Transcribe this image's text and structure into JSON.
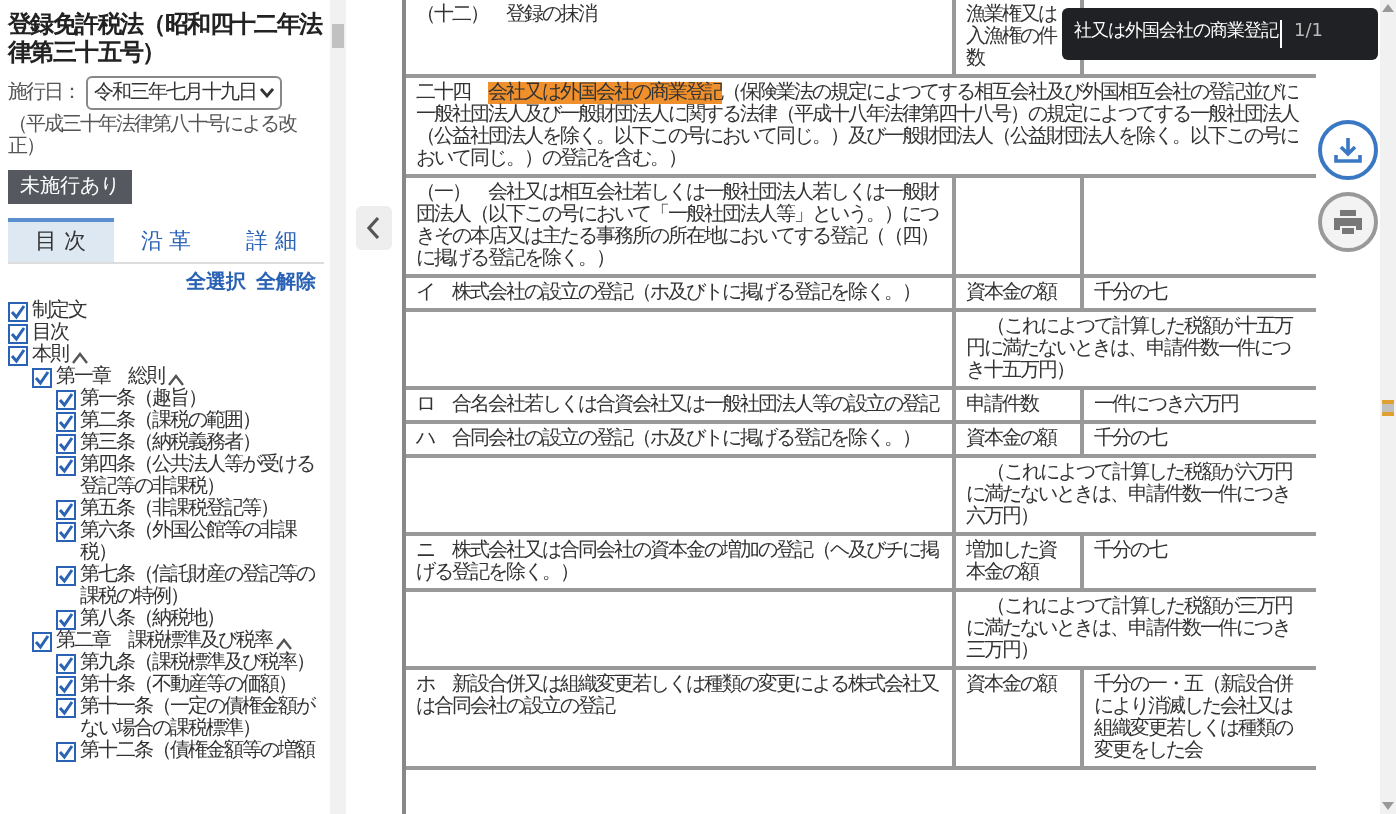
{
  "sidebar": {
    "law_title": "登録免許税法（昭和四十二年法律第三十五号）",
    "date_label": "施行日：",
    "date_value": "令和三年七月十九日",
    "amendment_note": "（平成三十年法律第八十号による改正）",
    "unenforced_button": "未施行あり",
    "tabs": [
      {
        "label": "目 次",
        "selected": true
      },
      {
        "label": "沿 革",
        "selected": false
      },
      {
        "label": "詳 細",
        "selected": false
      }
    ],
    "select_all": "全選択",
    "deselect_all": "全解除",
    "tree": [
      {
        "label": "制定文",
        "checked": true
      },
      {
        "label": "目次",
        "checked": true
      },
      {
        "label": "本則",
        "checked": true,
        "expanded": true,
        "children": [
          {
            "label": "第一章　総則",
            "checked": true,
            "expanded": true,
            "children": [
              {
                "label": "第一条（趣旨）",
                "checked": true
              },
              {
                "label": "第二条（課税の範囲）",
                "checked": true
              },
              {
                "label": "第三条（納税義務者）",
                "checked": true
              },
              {
                "label": "第四条（公共法人等が受ける登記等の非課税）",
                "checked": true
              },
              {
                "label": "第五条（非課税登記等）",
                "checked": true
              },
              {
                "label": "第六条（外国公館等の非課税）",
                "checked": true
              },
              {
                "label": "第七条（信託財産の登記等の課税の特例）",
                "checked": true
              },
              {
                "label": "第八条（納税地）",
                "checked": true
              }
            ]
          },
          {
            "label": "第二章　課税標準及び税率",
            "checked": true,
            "expanded": true,
            "children": [
              {
                "label": "第九条（課税標準及び税率）",
                "checked": true
              },
              {
                "label": "第十条（不動産等の価額）",
                "checked": true
              },
              {
                "label": "第十一条（一定の債権金額がない場合の課税標準）",
                "checked": true
              },
              {
                "label": "第十二条（債権金額等の増額",
                "checked": true
              }
            ]
          }
        ]
      }
    ]
  },
  "table": {
    "rows": [
      {
        "kind": "item",
        "item": "（十二）　登録の抹消",
        "base": "漁業権又は入漁権の件数",
        "rate": ""
      },
      {
        "kind": "full",
        "number": "二十四",
        "highlighted": "会社又は外国会社の商業登記",
        "text": "（保険業法の規定によつてする相互会社及び外国相互会社の登記並びに一般社団法人及び一般財団法人に関する法律（平成十八年法律第四十八号）の規定によつてする一般社団法人（公益社団法人を除く。以下この号において同じ。）及び一般財団法人（公益財団法人を除く。以下この号において同じ。）の登記を含む。）"
      },
      {
        "kind": "item",
        "item": "（一）　会社又は相互会社若しくは一般社団法人若しくは一般財団法人（以下この号において「一般社団法人等」という。）につきその本店又は主たる事務所の所在地においてする登記（（四）に掲げる登記を除く。）",
        "base": "",
        "rate": ""
      },
      {
        "kind": "item",
        "item": "イ　株式会社の設立の登記（ホ及びトに掲げる登記を除く。）",
        "base": "資本金の額",
        "rate": "千分の七"
      },
      {
        "kind": "note",
        "text": "（これによつて計算した税額が十五万円に満たないときは、申請件数一件につき十五万円）"
      },
      {
        "kind": "item",
        "item": "ロ　合名会社若しくは合資会社又は一般社団法人等の設立の登記",
        "base": "申請件数",
        "rate": "一件につき六万円"
      },
      {
        "kind": "item",
        "item": "ハ　合同会社の設立の登記（ホ及びトに掲げる登記を除く。）",
        "base": "資本金の額",
        "rate": "千分の七"
      },
      {
        "kind": "note",
        "text": "（これによつて計算した税額が六万円に満たないときは、申請件数一件につき六万円）"
      },
      {
        "kind": "item",
        "item": "ニ　株式会社又は合同会社の資本金の増加の登記（ヘ及びチに掲げる登記を除く。）",
        "base": "増加した資本金の額",
        "rate": "千分の七"
      },
      {
        "kind": "note",
        "text": "（これによつて計算した税額が三万円に満たないときは、申請件数一件につき三万円）"
      },
      {
        "kind": "item",
        "item": "ホ　新設合併又は組織変更若しくは種類の変更による株式会社又は合同会社の設立の登記",
        "base": "資本金の額",
        "rate": "千分の一・五（新設合併により消滅した会社又は組織変更若しくは種類の変更をした会"
      }
    ]
  },
  "find_bar": {
    "query": "社又は外国会社の商業登記",
    "count": "1/1"
  }
}
